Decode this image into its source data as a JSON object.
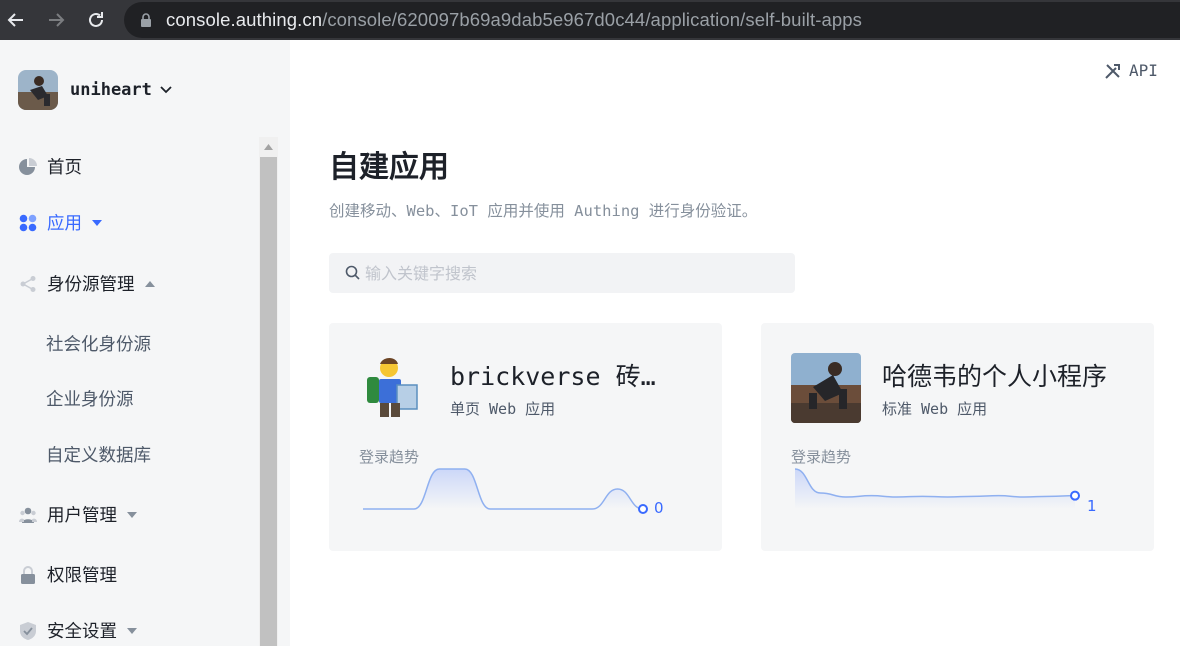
{
  "browser": {
    "url_host": "console.authing.cn",
    "url_path": "/console/620097b69a9dab5e967d0c44/application/self-built-apps"
  },
  "sidebar": {
    "user_name": "uniheart",
    "items": [
      {
        "label": "首页",
        "icon": "pie-chart-icon"
      },
      {
        "label": "应用",
        "icon": "apps-icon",
        "active": true
      },
      {
        "label": "身份源管理",
        "icon": "share-icon"
      },
      {
        "label": "用户管理",
        "icon": "users-icon"
      },
      {
        "label": "权限管理",
        "icon": "lock-icon"
      },
      {
        "label": "安全设置",
        "icon": "shield-icon"
      }
    ],
    "sub_items": [
      "社会化身份源",
      "企业身份源",
      "自定义数据库"
    ]
  },
  "header": {
    "api_label": "API"
  },
  "main": {
    "title": "自建应用",
    "description": "创建移动、Web、IoT 应用并使用 Authing 进行身份验证。",
    "search_placeholder": "输入关键字搜索",
    "apps": [
      {
        "name": "brickverse 砖…",
        "type": "单页 Web 应用",
        "trend_label": "登录趋势",
        "count": "0",
        "trend": [
          0,
          0,
          0,
          1,
          1,
          0,
          0,
          0,
          0,
          0,
          0.5,
          0
        ]
      },
      {
        "name": "哈德韦的个人小程序",
        "type": "标准 Web 应用",
        "trend_label": "登录趋势",
        "count": "1",
        "trend": [
          3,
          1.2,
          0.9,
          1,
          0.9,
          0.95,
          0.9,
          0.95,
          1,
          0.9,
          0.95,
          1
        ]
      }
    ]
  },
  "colors": {
    "accent": "#396aff",
    "sidebar_bg": "#f5f6f7",
    "card_bg": "#f5f6f7"
  }
}
